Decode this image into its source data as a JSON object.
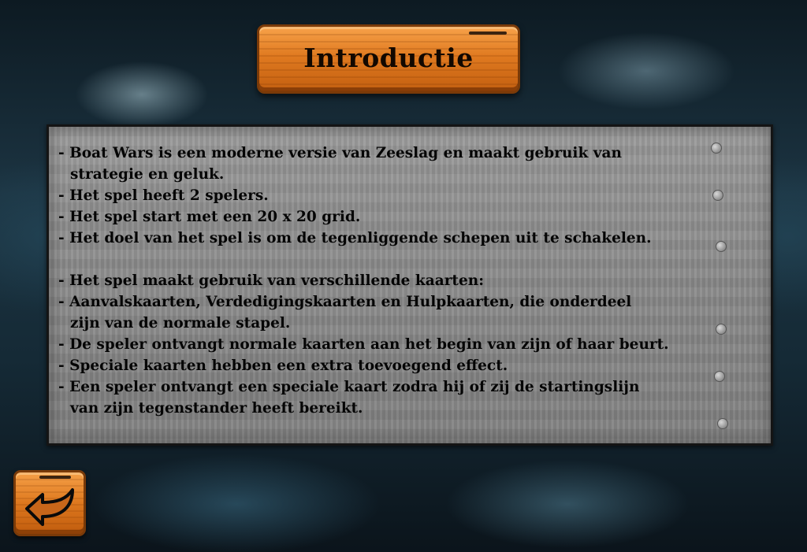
{
  "title": "Introductie",
  "intro_lines": [
    "- Boat Wars is een moderne versie van Zeeslag en maakt gebruik van",
    "strategie en geluk.",
    "- Het spel heeft 2 spelers.",
    "- Het spel start met een 20 x 20 grid.",
    "- Het doel van het spel is om de tegenliggende schepen uit te schakelen.",
    "",
    "- Het spel maakt gebruik van verschillende kaarten:",
    "- Aanvalskaarten, Verdedigingskaarten en Hulpkaarten, die onderdeel",
    "zijn van de normale stapel.",
    "- De speler ontvangt normale kaarten aan het begin van zijn of haar beurt.",
    "- Speciale kaarten hebben een extra toevoegend effect.",
    "- Een speler ontvangt een speciale kaart zodra hij of zij de startingslijn",
    "van zijn tegenstander heeft bereikt."
  ],
  "back_button": {
    "icon": "back-arrow-icon"
  },
  "colors": {
    "plank": "#e07a20",
    "plank_border": "#7a3a08",
    "panel": "#8a8a8a",
    "text": "#050505"
  }
}
